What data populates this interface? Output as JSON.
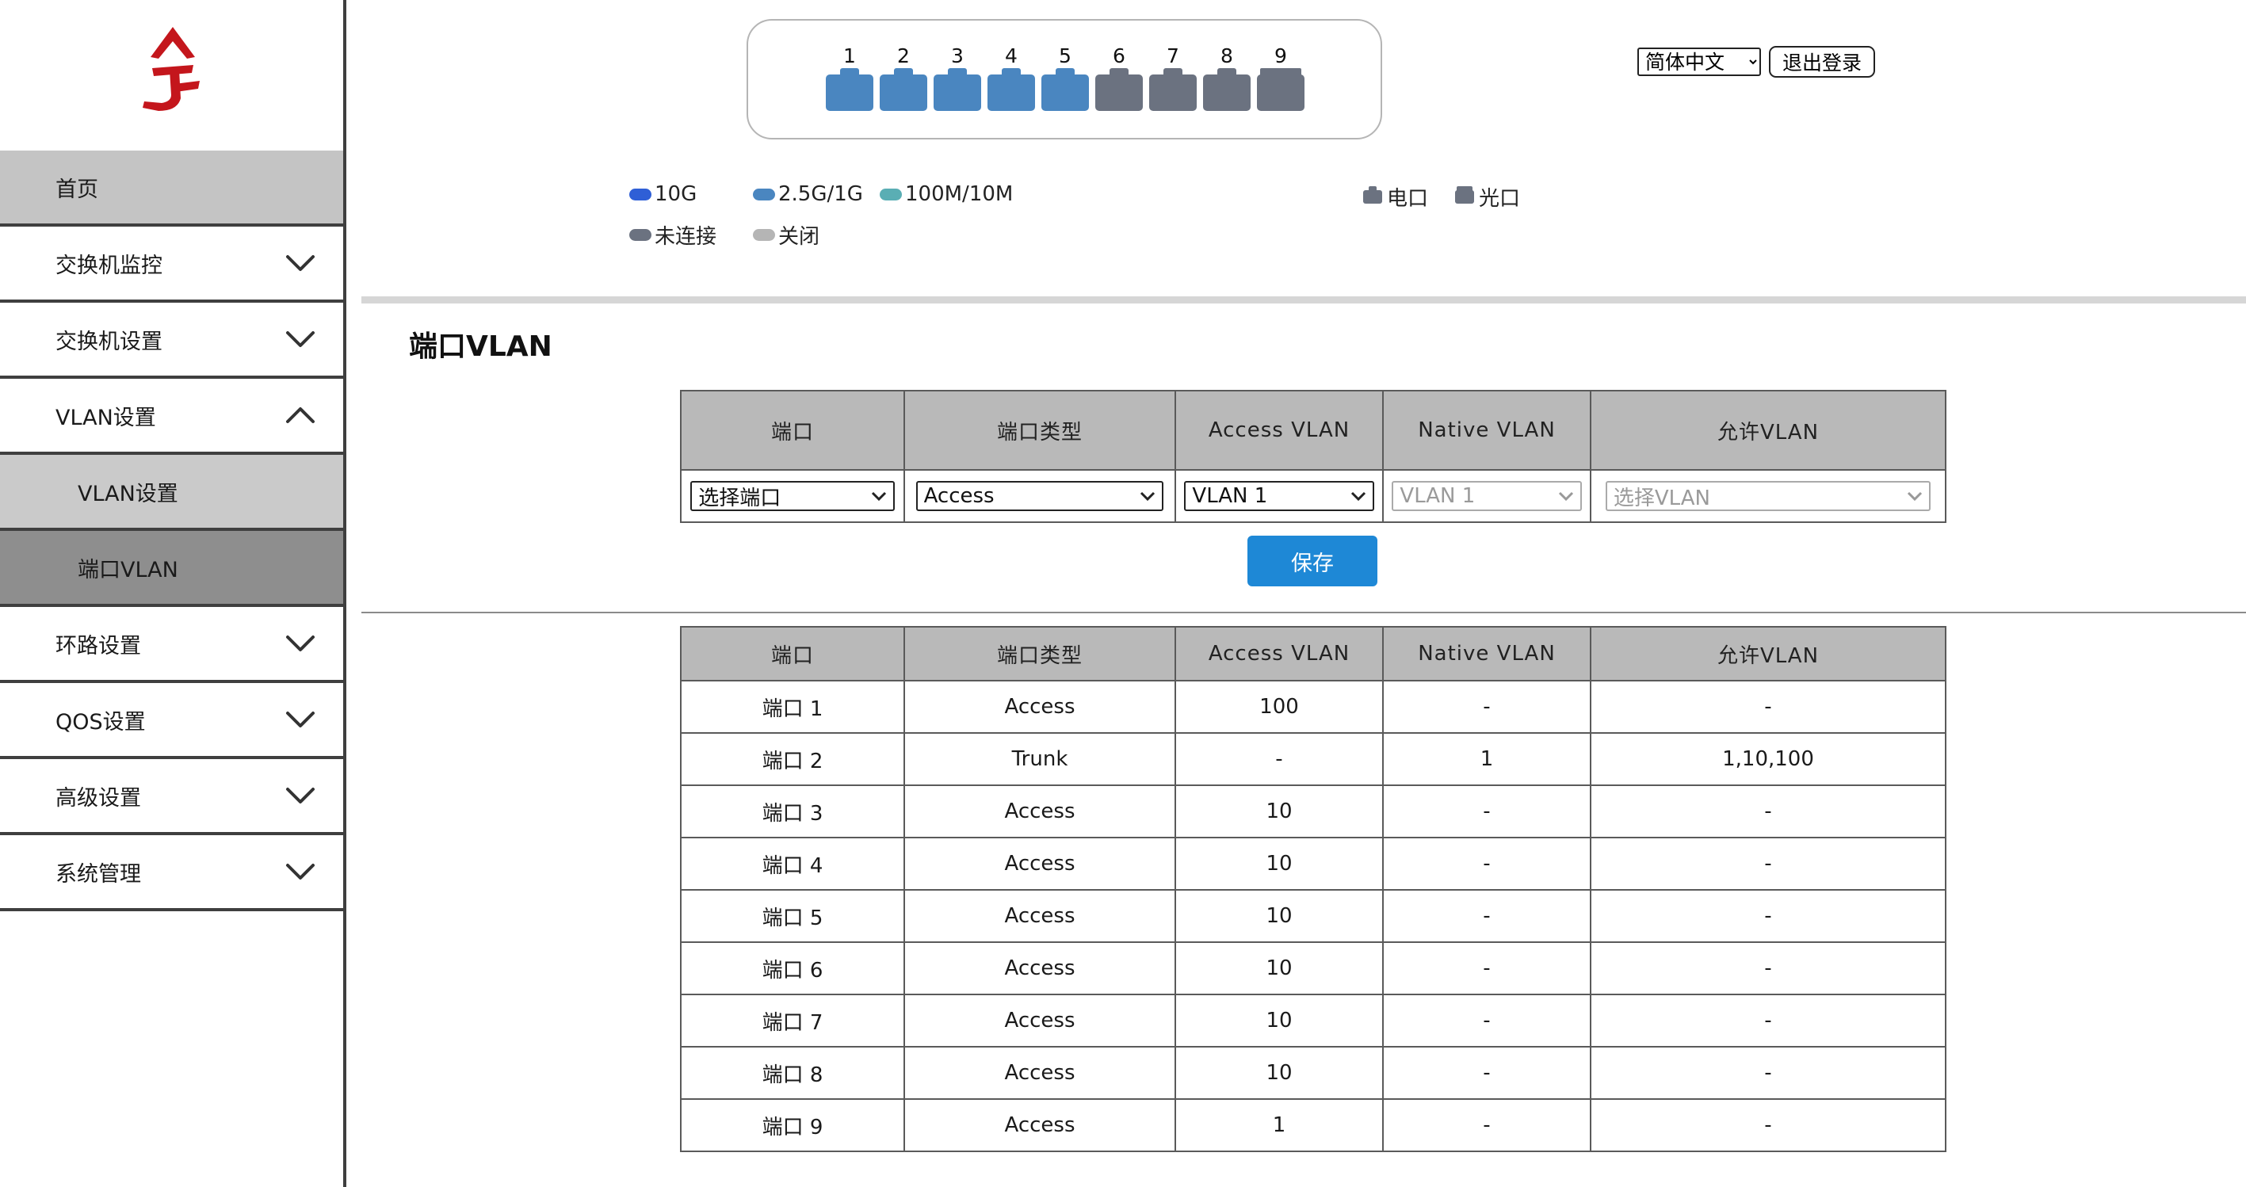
{
  "sidebar": {
    "items": [
      {
        "label": "首页"
      },
      {
        "label": "交换机监控"
      },
      {
        "label": "交换机设置"
      },
      {
        "label": "VLAN设置"
      },
      {
        "label": "VLAN设置"
      },
      {
        "label": "端口VLAN"
      },
      {
        "label": "环路设置"
      },
      {
        "label": "QOS设置"
      },
      {
        "label": "高级设置"
      },
      {
        "label": "系统管理"
      }
    ]
  },
  "ports": [
    {
      "num": "1",
      "status": "2.5G/1G",
      "color": "#4a86c0"
    },
    {
      "num": "2",
      "status": "2.5G/1G",
      "color": "#4a86c0"
    },
    {
      "num": "3",
      "status": "2.5G/1G",
      "color": "#4a86c0"
    },
    {
      "num": "4",
      "status": "2.5G/1G",
      "color": "#4a86c0"
    },
    {
      "num": "5",
      "status": "2.5G/1G",
      "color": "#4a86c0"
    },
    {
      "num": "6",
      "status": "未连接",
      "color": "#6b7280"
    },
    {
      "num": "7",
      "status": "未连接",
      "color": "#6b7280"
    },
    {
      "num": "8",
      "status": "未连接",
      "color": "#6b7280"
    },
    {
      "num": "9",
      "status": "未连接",
      "color": "#6b7280",
      "type": "光口"
    }
  ],
  "legend": {
    "speed_10g": "10G",
    "speed_2g5": "2.5G/1G",
    "speed_100m": "100M/10M",
    "disconnected": "未连接",
    "closed": "关闭",
    "copper": "电口",
    "fiber": "光口",
    "colors": {
      "10g": "#2f5fd6",
      "2g5": "#4a86c0",
      "100m": "#5aaeb4",
      "disconnected": "#6b7280",
      "closed": "#b5b5b5"
    }
  },
  "header": {
    "language": "简体中文",
    "logout": "退出登录"
  },
  "section_title": "端口VLAN",
  "columns": [
    "端口",
    "端口类型",
    "Access VLAN",
    "Native VLAN",
    "允许VLAN"
  ],
  "config": {
    "port_select": "选择端口",
    "port_type": "Access",
    "access_vlan": "VLAN 1",
    "native_vlan": "VLAN 1",
    "allowed_vlan": "选择VLAN"
  },
  "save_label": "保存",
  "rows": [
    [
      "端口 1",
      "Access",
      "100",
      "-",
      "-"
    ],
    [
      "端口 2",
      "Trunk",
      "-",
      "1",
      "1,10,100"
    ],
    [
      "端口 3",
      "Access",
      "10",
      "-",
      "-"
    ],
    [
      "端口 4",
      "Access",
      "10",
      "-",
      "-"
    ],
    [
      "端口 5",
      "Access",
      "10",
      "-",
      "-"
    ],
    [
      "端口 6",
      "Access",
      "10",
      "-",
      "-"
    ],
    [
      "端口 7",
      "Access",
      "10",
      "-",
      "-"
    ],
    [
      "端口 8",
      "Access",
      "10",
      "-",
      "-"
    ],
    [
      "端口 9",
      "Access",
      "1",
      "-",
      "-"
    ]
  ]
}
